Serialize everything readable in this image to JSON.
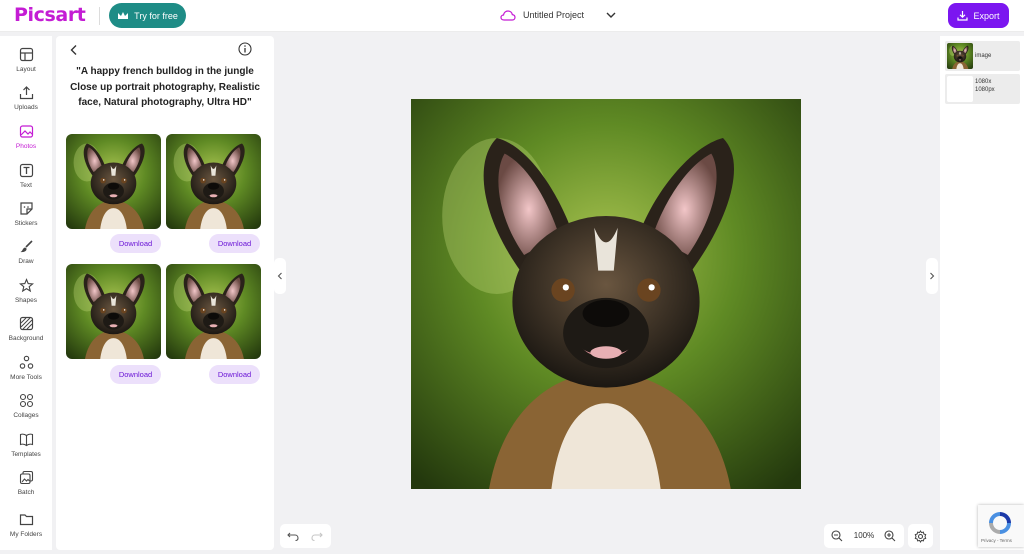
{
  "app": {
    "logo_text": "Picsart",
    "brand_color": "#c41cd4",
    "accent_color": "#7b16f0"
  },
  "header": {
    "try_free_label": "Try for free",
    "try_free_icon": "crown-icon",
    "project_title": "Untitled Project",
    "project_icon": "cloud-icon",
    "export_label": "Export",
    "export_icon": "download-icon"
  },
  "toolbar": {
    "active": "Photos",
    "items": [
      {
        "label": "Layout",
        "icon": "layout-icon"
      },
      {
        "label": "Uploads",
        "icon": "upload-icon"
      },
      {
        "label": "Photos",
        "icon": "photo-icon"
      },
      {
        "label": "Text",
        "icon": "text-icon"
      },
      {
        "label": "Stickers",
        "icon": "sticker-icon"
      },
      {
        "label": "Draw",
        "icon": "brush-icon"
      },
      {
        "label": "Shapes",
        "icon": "star-icon"
      },
      {
        "label": "Background",
        "icon": "background-icon"
      },
      {
        "label": "More Tools",
        "icon": "more-tools-icon"
      },
      {
        "label": "Collages",
        "icon": "collage-icon"
      },
      {
        "label": "Templates",
        "icon": "book-icon"
      },
      {
        "label": "Batch",
        "icon": "batch-icon"
      },
      {
        "label": "My Folders",
        "icon": "folder-icon"
      }
    ]
  },
  "panel": {
    "prompt": "\"A happy french bulldog in the jungle Close up portrait photography, Realistic face, Natural photography, Ultra HD\"",
    "download_label": "Download",
    "results_count": 4
  },
  "layers": {
    "items": [
      {
        "label": "image"
      },
      {
        "label": "1080x 1080px"
      }
    ]
  },
  "zoom": {
    "value": "100%"
  },
  "recaptcha": {
    "links": "Privacy - Terms"
  }
}
